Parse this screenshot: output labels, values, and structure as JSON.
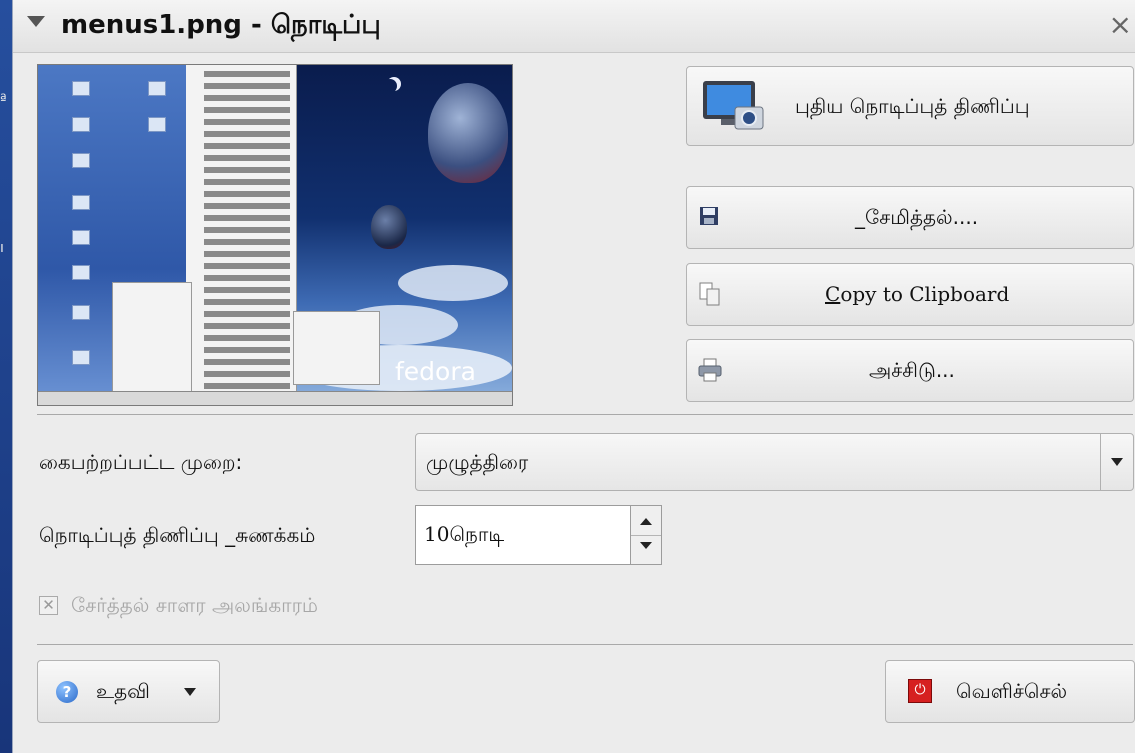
{
  "window": {
    "title": "menus1.png - நொடிப்பு"
  },
  "actions": {
    "new_snapshot": "புதிய நொடிப்புத் திணிப்பு",
    "save": "_சேமித்தல்....",
    "copy": "Copy to Clipboard",
    "copy_mnemonic": "C",
    "copy_rest": "opy to Clipboard",
    "print": "அச்சிடு..."
  },
  "capture_mode": {
    "label": "கைபற்றப்பட்ட முறை:",
    "value": "முழுத்திரை"
  },
  "delay": {
    "label": "நொடிப்புத் திணிப்பு _சுணக்கம்",
    "value": "10நொடி"
  },
  "decorations": {
    "label": "சேர்த்தல் சாளர அலங்காரம்",
    "checked": true,
    "enabled": false
  },
  "footer": {
    "help": "உதவி",
    "quit": "வெளிச்செல்"
  },
  "preview": {
    "brand": "fedora"
  },
  "colors": {
    "desktop": "#1d3f8a",
    "window_bg": "#ececec",
    "quit_icon": "#d62020",
    "help_icon": "#2a69c9"
  }
}
